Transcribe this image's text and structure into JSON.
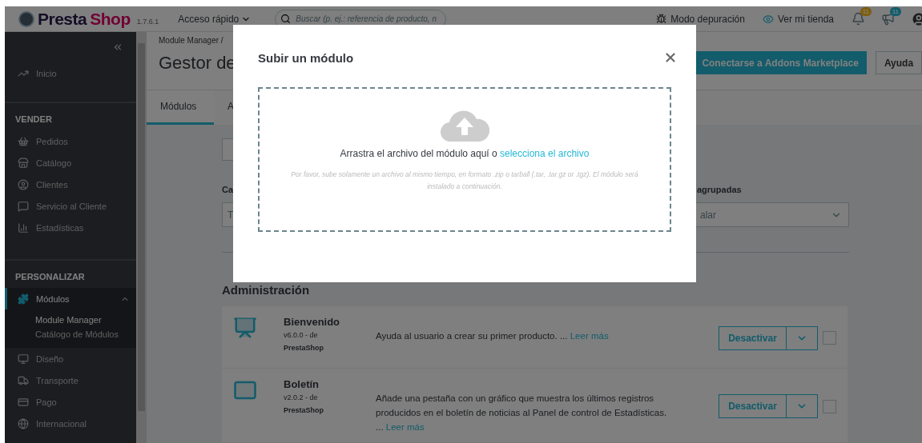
{
  "header": {
    "logo": [
      "Presta",
      "Shop"
    ],
    "version": "1.7.6.1",
    "quick_access": "Acceso rápido",
    "search": {
      "placeholder": "Buscar (p. ej.: referencia de producto, n"
    },
    "debug": "Modo depuración",
    "view_store": "Ver mi tienda",
    "notifications": [
      {
        "count": "11",
        "color": "#7e5e11"
      },
      {
        "count": "11",
        "color": "#135d6c"
      }
    ]
  },
  "sidebar": {
    "top": [
      {
        "label": "Inicio",
        "selected": false
      }
    ],
    "sections": [
      {
        "title": "VENDER",
        "items": [
          {
            "label": "Pedidos",
            "selected": false
          },
          {
            "label": "Catálogo",
            "selected": false
          },
          {
            "label": "Clientes",
            "selected": false
          },
          {
            "label": "Servicio al Cliente",
            "selected": false
          },
          {
            "label": "Estadísticas",
            "selected": false
          }
        ]
      },
      {
        "title": "PERSONALIZAR",
        "items": [
          {
            "label": "Módulos",
            "selected": true,
            "expanded": true,
            "children": [
              {
                "label": "Module Manager",
                "selected": true
              },
              {
                "label": "Catálogo de Módulos",
                "selected": false
              }
            ]
          },
          {
            "label": "Diseño",
            "selected": false
          },
          {
            "label": "Transporte",
            "selected": false
          },
          {
            "label": "Pago",
            "selected": false
          },
          {
            "label": "Internacional",
            "selected": false
          }
        ]
      }
    ]
  },
  "page": {
    "breadcrumb": "Module Manager /",
    "title": "Gestor de",
    "actions": [
      "Conectarse a Addons Marketplace",
      "Ayuda"
    ],
    "tabs": [
      {
        "label": "Módulos",
        "selected": true
      },
      {
        "label": "A",
        "selected": false
      }
    ],
    "filters": {
      "category_label": "Ca",
      "category_value": "T",
      "group_label": "agrupadas",
      "group_value": "alar"
    },
    "section_title": "Administración",
    "modules": [
      {
        "name": "Bienvenido",
        "version": "v6.0.0 - de",
        "author": "PrestaShop",
        "description": "Ayuda al usuario a crear su primer producto. ...",
        "more": "Leer más",
        "action": "Desactivar",
        "checked": false
      },
      {
        "name": "Boletín",
        "version": "v2.0.2 - de",
        "author": "PrestaShop",
        "description": "Añade una pestaña con un gráfico que muestra los últimos registros producidos en el boletín de noticias al Panel de control de Estadísticas. ...",
        "more": "Leer más",
        "action": "Desactivar",
        "checked": false
      }
    ]
  },
  "modal": {
    "title": "Subir un módulo",
    "drop_text": "Arrastra el archivo del módulo aquí o",
    "drop_link": "selecciona el archivo",
    "hint": "Por favor, sube solamente un archivo al mismo tiempo, en formato .zip o tarball (.tar, .tar.gz or .tgz). El módulo será instalado a continuación."
  }
}
